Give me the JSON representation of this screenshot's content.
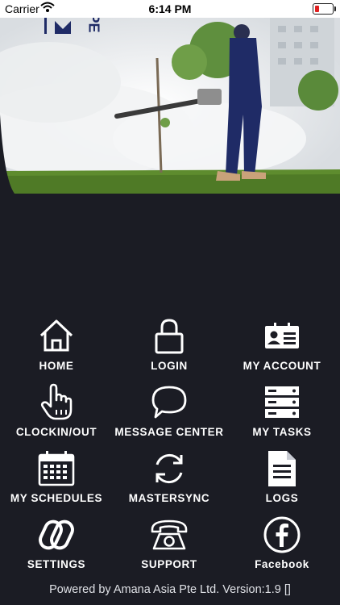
{
  "status_bar": {
    "carrier": "Carrier",
    "time": "6:14 PM",
    "battery_color": "#e02020"
  },
  "hero": {
    "logo_text": "PE"
  },
  "menu": [
    {
      "label": "HOME",
      "icon": "home-icon"
    },
    {
      "label": "LOGIN",
      "icon": "lock-icon"
    },
    {
      "label": "MY ACCOUNT",
      "icon": "id-card-icon"
    },
    {
      "label": "CLOCKIN/OUT",
      "icon": "hand-pointer-icon"
    },
    {
      "label": "MESSAGE CENTER",
      "icon": "speech-bubble-icon"
    },
    {
      "label": "MY TASKS",
      "icon": "tasks-stack-icon"
    },
    {
      "label": "MY SCHEDULES",
      "icon": "calendar-icon"
    },
    {
      "label": "MASTERSYNC",
      "icon": "sync-icon"
    },
    {
      "label": "LOGS",
      "icon": "document-icon"
    },
    {
      "label": "SETTINGS",
      "icon": "link-icon"
    },
    {
      "label": "SUPPORT",
      "icon": "telephone-icon"
    },
    {
      "label": "Facebook",
      "icon": "facebook-icon"
    }
  ],
  "footer": {
    "text": "Powered by Amana Asia Pte Ltd. Version:1.9  []"
  },
  "colors": {
    "background": "#1b1c24",
    "text": "#ffffff"
  }
}
